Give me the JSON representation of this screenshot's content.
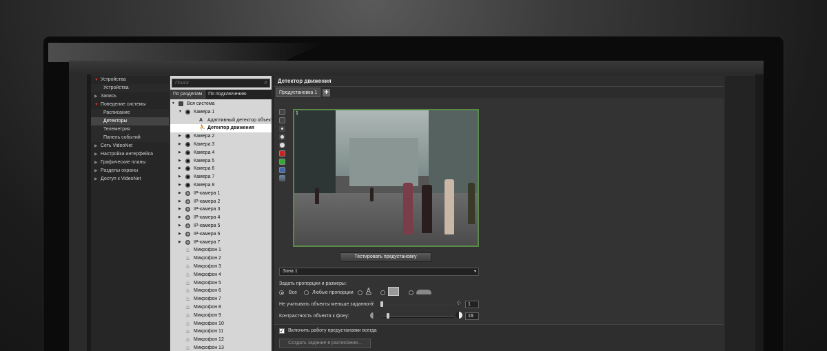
{
  "nav": {
    "items": [
      {
        "label": "Устройства",
        "type": "section",
        "open": true
      },
      {
        "label": "Устройства",
        "type": "sub"
      },
      {
        "label": "Запись",
        "type": "section",
        "open": false
      },
      {
        "label": "Поведение системы",
        "type": "section",
        "open": true
      },
      {
        "label": "Расписание",
        "type": "sub"
      },
      {
        "label": "Детекторы",
        "type": "sub",
        "selected": true
      },
      {
        "label": "Телеметрия",
        "type": "sub"
      },
      {
        "label": "Панель событий",
        "type": "sub"
      },
      {
        "label": "Сеть VideoNet",
        "type": "section",
        "open": false
      },
      {
        "label": "Настройка интерфейса",
        "type": "section",
        "open": false
      },
      {
        "label": "Графические планы",
        "type": "section",
        "open": false
      },
      {
        "label": "Разделы охраны",
        "type": "section",
        "open": false
      },
      {
        "label": "Доступ к VideoNet",
        "type": "section",
        "open": false
      }
    ]
  },
  "tree": {
    "search_placeholder": "Поиск",
    "tabs": [
      "По разделам",
      "По подключению"
    ],
    "nodes": [
      {
        "label": "Вся система",
        "level": 0,
        "icon": "system",
        "arrow": "open"
      },
      {
        "label": "Камера 1",
        "level": 1,
        "icon": "cam",
        "arrow": "open"
      },
      {
        "label": "Адаптивный детектор объектов",
        "level": 2,
        "icon": "adaptive"
      },
      {
        "label": "Детектор движения",
        "level": 2,
        "icon": "motion",
        "selected": true
      },
      {
        "label": "Камера 2",
        "level": 1,
        "icon": "cam",
        "arrow": "closed"
      },
      {
        "label": "Камера 3",
        "level": 1,
        "icon": "cam",
        "arrow": "closed"
      },
      {
        "label": "Камера 4",
        "level": 1,
        "icon": "cam",
        "arrow": "closed"
      },
      {
        "label": "Камера 5",
        "level": 1,
        "icon": "cam",
        "arrow": "closed"
      },
      {
        "label": "Камера 6",
        "level": 1,
        "icon": "cam",
        "arrow": "closed"
      },
      {
        "label": "Камера 7",
        "level": 1,
        "icon": "cam",
        "arrow": "closed"
      },
      {
        "label": "Камера 8",
        "level": 1,
        "icon": "cam",
        "arrow": "closed"
      },
      {
        "label": "IP-камера 1",
        "level": 1,
        "icon": "ip",
        "arrow": "closed"
      },
      {
        "label": "IP-камера 2",
        "level": 1,
        "icon": "ip",
        "arrow": "closed"
      },
      {
        "label": "IP-камера 3",
        "level": 1,
        "icon": "ip",
        "arrow": "closed"
      },
      {
        "label": "IP-камера 4",
        "level": 1,
        "icon": "ip",
        "arrow": "closed"
      },
      {
        "label": "IP-камера 5",
        "level": 1,
        "icon": "ip",
        "arrow": "closed"
      },
      {
        "label": "IP-камера 6",
        "level": 1,
        "icon": "ip",
        "arrow": "closed"
      },
      {
        "label": "IP-камера 7",
        "level": 1,
        "icon": "ip",
        "arrow": "closed"
      },
      {
        "label": "Микрофон 1",
        "level": 1,
        "icon": "mic"
      },
      {
        "label": "Микрофон 2",
        "level": 1,
        "icon": "mic"
      },
      {
        "label": "Микрофон 3",
        "level": 1,
        "icon": "mic"
      },
      {
        "label": "Микрофон 4",
        "level": 1,
        "icon": "mic"
      },
      {
        "label": "Микрофон 5",
        "level": 1,
        "icon": "mic"
      },
      {
        "label": "Микрофон 6",
        "level": 1,
        "icon": "mic"
      },
      {
        "label": "Микрофон 7",
        "level": 1,
        "icon": "mic"
      },
      {
        "label": "Микрофон 8",
        "level": 1,
        "icon": "mic"
      },
      {
        "label": "Микрофон 9",
        "level": 1,
        "icon": "mic"
      },
      {
        "label": "Микрофон 10",
        "level": 1,
        "icon": "mic"
      },
      {
        "label": "Микрофон 11",
        "level": 1,
        "icon": "mic"
      },
      {
        "label": "Микрофон 12",
        "level": 1,
        "icon": "mic"
      },
      {
        "label": "Микрофон 13",
        "level": 1,
        "icon": "mic"
      }
    ]
  },
  "main": {
    "title": "Детектор движения",
    "preset_tab": "Предустановка 1",
    "add_preset": "+",
    "video_index": "1",
    "test_button": "Тестировать предустановку",
    "zone": "Зона 1",
    "proportions_label": "Задать пропорции и размеры:",
    "radio_all": "Все",
    "radio_any": "Любые пропорции",
    "min_size_label": "Не учитывать объекты меньше заданного:",
    "min_size_value": "1",
    "contrast_label": "Контрастность объекта к фону:",
    "contrast_value": "16",
    "enable_label": "Включить работу предустановки всегда",
    "schedule_button": "Создать задание в расписании..."
  }
}
